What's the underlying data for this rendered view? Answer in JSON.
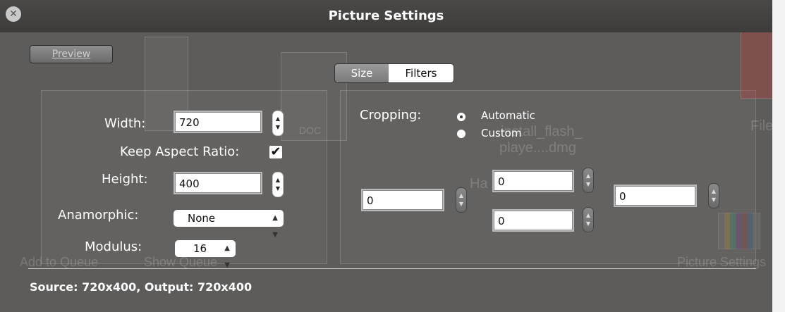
{
  "window": {
    "title": "Picture Settings"
  },
  "preview_button": {
    "label": "Preview"
  },
  "tabs": [
    {
      "label": "Size",
      "selected": true
    },
    {
      "label": "Filters",
      "selected": false
    }
  ],
  "size": {
    "width": {
      "label": "Width:",
      "value": "720"
    },
    "keep_aspect_ratio": {
      "label": "Keep Aspect Ratio:",
      "checked": true,
      "mark": "✔"
    },
    "height": {
      "label": "Height:",
      "value": "400"
    },
    "anamorphic": {
      "label": "Anamorphic:",
      "value": "None"
    },
    "modulus": {
      "label": "Modulus:",
      "value": "16"
    }
  },
  "cropping": {
    "label": "Cropping:",
    "options": [
      {
        "label": "Automatic",
        "selected": true
      },
      {
        "label": "Custom",
        "selected": false
      }
    ],
    "left": "0",
    "top": "0",
    "bottom": "0",
    "right": "0"
  },
  "status": "Source: 720x400, Output: 720x400",
  "background_window": {
    "toolbar_items": [
      "Add to Queue",
      "Show Queue",
      "Picture Settings"
    ],
    "file_items": [
      "install_flash_",
      "playe....dmg",
      "DOC",
      "Filez",
      "Ha"
    ]
  },
  "icons": {
    "close": "close-icon",
    "stepper": "stepper-arrows-icon",
    "popup": "popup-arrows-icon",
    "check": "checkmark-icon"
  },
  "colors": {
    "hud_background": "#5d5c5a",
    "titlebar": "#3d3c3a",
    "text": "#ffffff"
  }
}
